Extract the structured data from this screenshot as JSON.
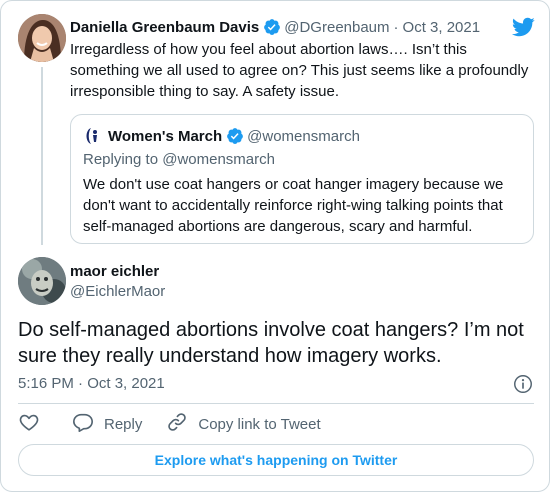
{
  "parent_tweet": {
    "name": "Daniella Greenbaum Davis",
    "handle": "@DGreenbaum",
    "separator": "·",
    "date": "Oct 3, 2021",
    "text": "Irregardless of how you feel about abortion laws…. Isn’t this something we all used to agree on? This just seems like a profoundly irresponsible thing to say. A safety issue."
  },
  "quoted_tweet": {
    "name": "Women's March",
    "handle": "@womensmarch",
    "replying_to": "Replying to @womensmarch",
    "text": "We don't use coat hangers or coat hanger imagery because we don't want to accidentally reinforce right-wing talking points that self-managed abortions are dangerous, scary and harmful."
  },
  "main_tweet": {
    "name": "maor eichler",
    "handle": "@EichlerMaor",
    "text": "Do self-managed abortions involve coat hangers? I’m not sure they really understand how imagery works.",
    "timestamp": "5:16 PM · Oct 3, 2021"
  },
  "actions": {
    "reply_label": "Reply",
    "copy_label": "Copy link to Tweet"
  },
  "explore_label": "Explore what's happening on Twitter",
  "icons": {
    "brand": "twitter-bird-icon",
    "verified": "verified-badge-icon",
    "like": "heart-icon",
    "reply": "speech-bubble-icon",
    "copy": "link-icon",
    "info": "info-icon"
  },
  "colors": {
    "accent": "#1d9bf0",
    "text": "#0f1419",
    "secondary": "#536471",
    "border": "#cfd9de"
  }
}
